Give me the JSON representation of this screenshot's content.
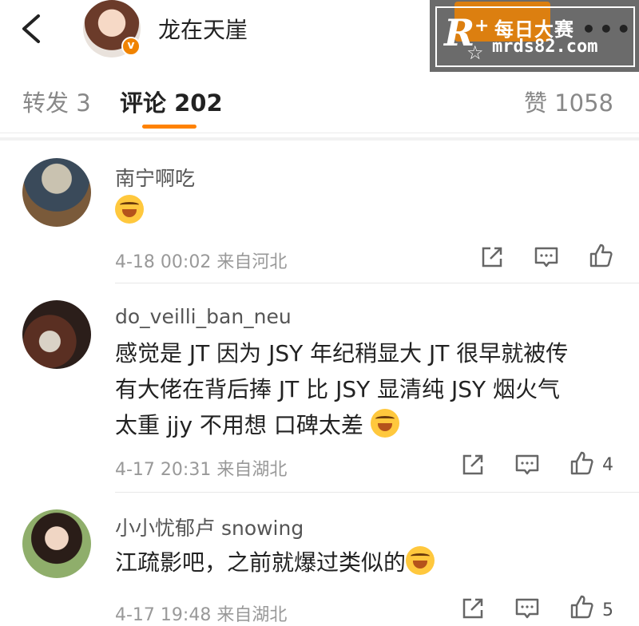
{
  "header": {
    "title": "龙在天崖",
    "verified_badge": "v",
    "more": "•••"
  },
  "watermark": {
    "logo_letter": "R",
    "plus": "+",
    "name": "每日大赛",
    "url": "mrds82.com"
  },
  "tabs": {
    "repost": "转发 3",
    "comment": "评论 202",
    "like": "赞 1058"
  },
  "comments": [
    {
      "name": "南宁啊吃",
      "text": "",
      "meta": "4-18 00:02 来自河北",
      "likes": ""
    },
    {
      "name": "do_veilli_ban_neu",
      "text_lines": [
        "感觉是 JT   因为 JSY 年纪稍显大 JT 很早就被传",
        "有大佬在背后捧 JT 比 JSY 显清纯 JSY 烟火气",
        "太重 jjy 不用想 口碑太差"
      ],
      "meta": "4-17 20:31 来自湖北",
      "likes": "4"
    },
    {
      "name": "小小忧郁卢 snowing",
      "text": "江疏影吧，之前就爆过类似的",
      "meta": "4-17 19:48 来自湖北",
      "likes": "5"
    }
  ],
  "colors": {
    "accent": "#ff8200",
    "meta_gray": "#999999"
  },
  "icons": [
    "back-arrow-icon",
    "verified-icon",
    "more-icon",
    "share-icon",
    "comment-icon",
    "like-icon",
    "laugh-cry-emoji"
  ]
}
